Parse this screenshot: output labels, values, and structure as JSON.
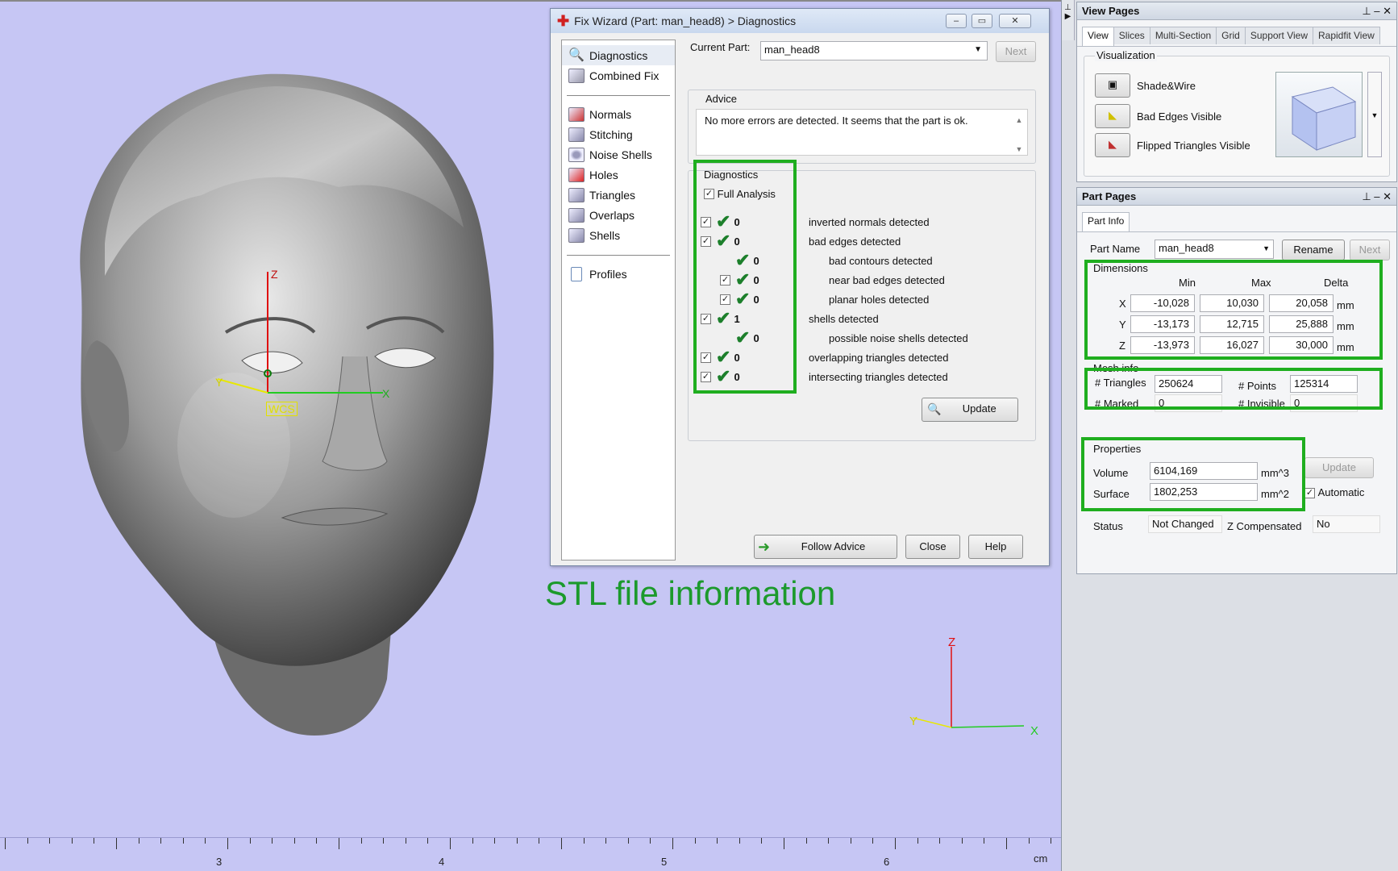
{
  "viewport": {
    "wcs_label": "WCS",
    "axis_z": "Z",
    "axis_x": "X",
    "axis_y": "Y",
    "small_axis_z": "Z",
    "small_axis_x": "X",
    "small_axis_y": "Y",
    "annotation": "STL file information",
    "ruler": {
      "labels": [
        "3",
        "4",
        "5",
        "6"
      ],
      "unit": "cm"
    }
  },
  "fix_wizard": {
    "title": "Fix Wizard (Part: man_head8) > Diagnostics",
    "nav": {
      "top": [
        "Diagnostics",
        "Combined Fix"
      ],
      "middle": [
        "Normals",
        "Stitching",
        "Noise Shells",
        "Holes",
        "Triangles",
        "Overlaps",
        "Shells"
      ],
      "bottom": [
        "Profiles"
      ]
    },
    "current_part_label": "Current Part:",
    "current_part_value": "man_head8",
    "next_label": "Next",
    "advice_title": "Advice",
    "advice_text": "No more errors are detected. It seems that the part is ok.",
    "diagnostics_title": "Diagnostics",
    "full_analysis_label": "Full Analysis",
    "rows": [
      {
        "count": "0",
        "label": "inverted normals detected",
        "indent": 0,
        "checkbox": true
      },
      {
        "count": "0",
        "label": "bad edges detected",
        "indent": 0,
        "checkbox": true
      },
      {
        "count": "0",
        "label": "bad contours detected",
        "indent": 1,
        "checkbox": false
      },
      {
        "count": "0",
        "label": "near bad edges detected",
        "indent": 1,
        "checkbox": true
      },
      {
        "count": "0",
        "label": "planar holes detected",
        "indent": 1,
        "checkbox": true
      },
      {
        "count": "1",
        "label": "shells detected",
        "indent": 0,
        "checkbox": true
      },
      {
        "count": "0",
        "label": "possible noise shells detected",
        "indent": 1,
        "checkbox": false
      },
      {
        "count": "0",
        "label": "overlapping triangles detected",
        "indent": 0,
        "checkbox": true
      },
      {
        "count": "0",
        "label": "intersecting triangles detected",
        "indent": 0,
        "checkbox": true
      }
    ],
    "update_label": "Update",
    "follow_advice_label": "Follow Advice",
    "close_label": "Close",
    "help_label": "Help"
  },
  "view_pages": {
    "title": "View Pages",
    "tabs": [
      "View",
      "Slices",
      "Multi-Section",
      "Grid",
      "Support View",
      "Rapidfit View"
    ],
    "visualization_title": "Visualization",
    "items": [
      "Shade&Wire",
      "Bad Edges Visible",
      "Flipped Triangles Visible"
    ]
  },
  "part_pages": {
    "title": "Part Pages",
    "tab": "Part Info",
    "part_name_label": "Part Name",
    "part_name_value": "man_head8",
    "rename_label": "Rename",
    "next_label": "Next",
    "dimensions_title": "Dimensions",
    "col_min": "Min",
    "col_max": "Max",
    "col_delta": "Delta",
    "dims": [
      {
        "axis": "X",
        "min": "-10,028",
        "max": "10,030",
        "delta": "20,058",
        "unit": "mm"
      },
      {
        "axis": "Y",
        "min": "-13,173",
        "max": "12,715",
        "delta": "25,888",
        "unit": "mm"
      },
      {
        "axis": "Z",
        "min": "-13,973",
        "max": "16,027",
        "delta": "30,000",
        "unit": "mm"
      }
    ],
    "mesh_title": "Mesh info",
    "triangles_label": "# Triangles",
    "triangles_value": "250624",
    "points_label": "# Points",
    "points_value": "125314",
    "marked_label": "# Marked",
    "marked_value": "0",
    "invisible_label": "# Invisible",
    "invisible_value": "0",
    "properties_title": "Properties",
    "volume_label": "Volume",
    "volume_value": "6104,169",
    "volume_unit": "mm^3",
    "surface_label": "Surface",
    "surface_value": "1802,253",
    "surface_unit": "mm^2",
    "update_label": "Update",
    "automatic_label": "Automatic",
    "status_label": "Status",
    "status_value": "Not Changed",
    "zcomp_label": "Z Compensated",
    "zcomp_value": "No"
  },
  "colors": {
    "highlight": "#1fae1f",
    "annotation": "#1c9a2c",
    "viewport_bg": "#c6c6f4"
  }
}
